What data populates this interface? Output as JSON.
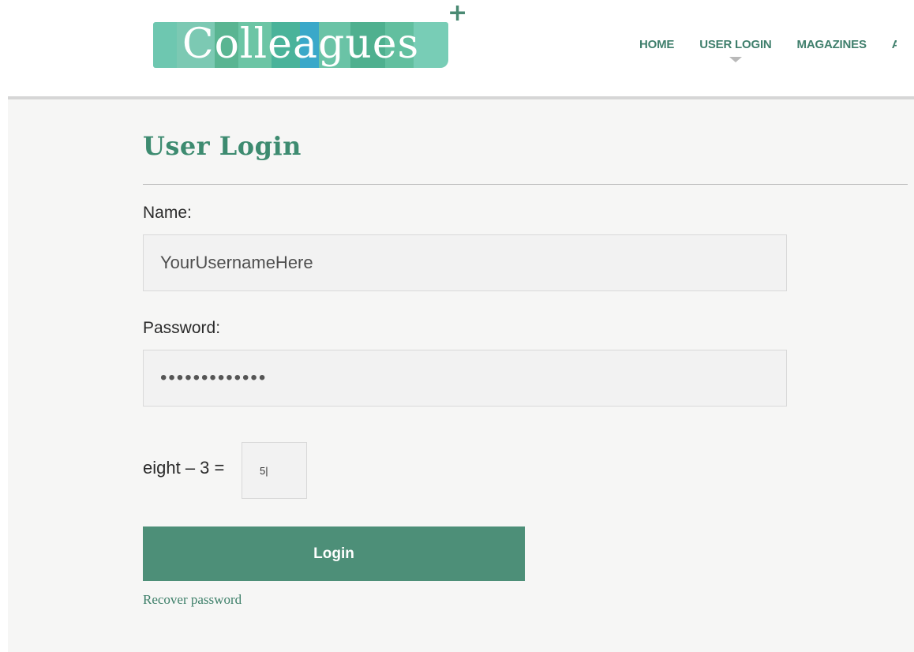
{
  "header": {
    "logo": {
      "text": "Colleagues",
      "plus": "+",
      "stripe_colors": [
        "#6ec7b0",
        "#7cc9b3",
        "#5ab592",
        "#6cc5a5",
        "#4ab39a",
        "#3aa8c9",
        "#6ac3a6",
        "#4fb08f",
        "#62bf9f",
        "#78cdb6"
      ]
    },
    "nav": {
      "items": [
        {
          "label": "HOME",
          "active": false
        },
        {
          "label": "USER LOGIN",
          "active": true
        },
        {
          "label": "MAGAZINES",
          "active": false
        },
        {
          "label": "A",
          "active": false
        }
      ]
    }
  },
  "main": {
    "title": "User Login",
    "name_field": {
      "label": "Name:",
      "value": "YourUsernameHere"
    },
    "password_field": {
      "label": "Password:",
      "value": "•••••••••••••"
    },
    "captcha": {
      "question": "eight – 3 =",
      "answer": "5|"
    },
    "login_button": "Login",
    "recover_link": "Recover password"
  },
  "colors": {
    "accent": "#4d8f78",
    "heading": "#3d8b70",
    "nav": "#3f7f6c",
    "background": "#f6f6f5"
  }
}
